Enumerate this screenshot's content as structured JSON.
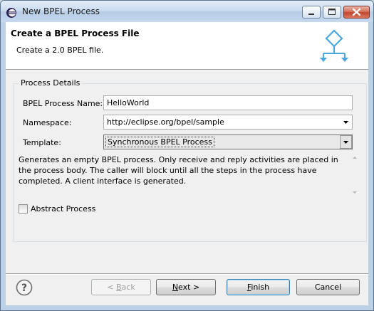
{
  "window": {
    "title": "New BPEL Process"
  },
  "banner": {
    "title": "Create a BPEL Process File",
    "message": "Create a 2.0 BPEL file.",
    "icon": "bpel-process-wizard-icon"
  },
  "process_details": {
    "group_title": "Process Details",
    "name_label": "BPEL Process Name:",
    "name_value": "HelloWorld",
    "namespace_label": "Namespace:",
    "namespace_value": "http://eclipse.org/bpel/sample",
    "template_label": "Template:",
    "template_value": "Synchronous BPEL Process",
    "template_description": "Generates an empty BPEL process. Only receive and reply activities are placed in the process body. The caller will block until all the steps in the process have completed. A client interface is generated.",
    "abstract_label": "Abstract Process",
    "abstract_checked": false
  },
  "buttons": {
    "back_prefix": "< ",
    "back_mnemonic": "B",
    "back_rest": "ack",
    "next_mnemonic": "N",
    "next_rest": "ext >",
    "finish_mnemonic": "F",
    "finish_rest": "inish",
    "cancel": "Cancel"
  },
  "colors": {
    "accent": "#3c7fb1",
    "banner_icon": "#49a8de"
  }
}
